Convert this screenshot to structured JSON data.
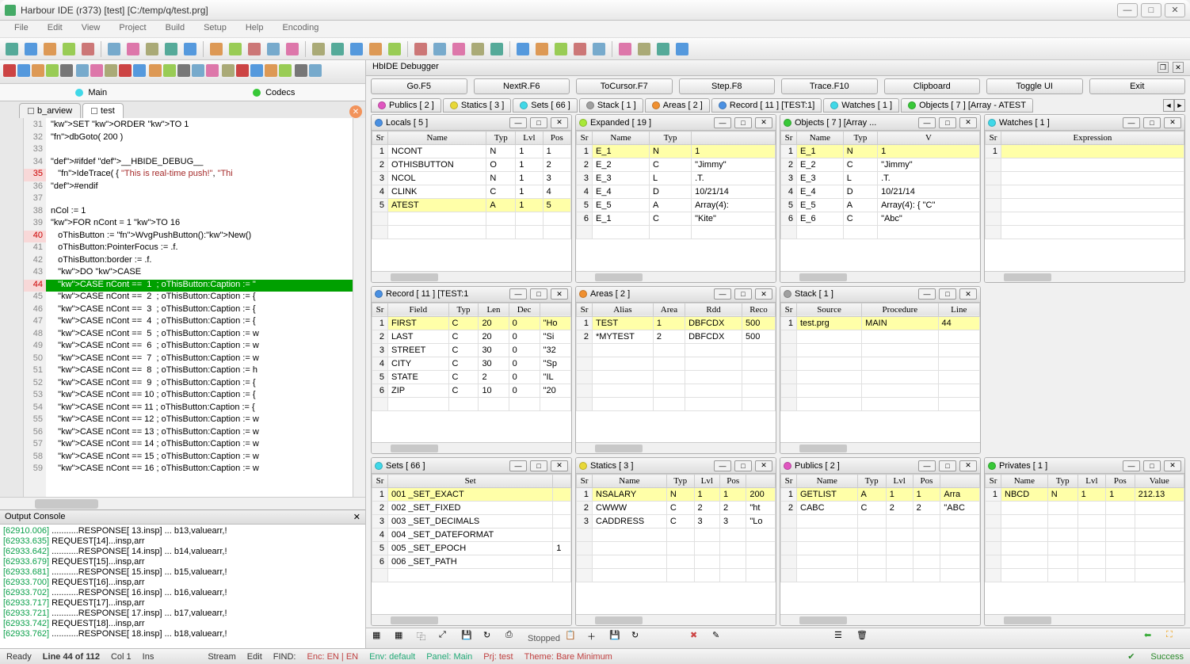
{
  "window": {
    "title": "Harbour IDE (r373) [test]   [C:/temp/q/test.prg]"
  },
  "menu": [
    "File",
    "Edit",
    "View",
    "Project",
    "Build",
    "Setup",
    "Help",
    "Encoding"
  ],
  "editor": {
    "tabgroups": [
      {
        "dot": "d-cyan",
        "label": "Main"
      },
      {
        "dot": "d-green",
        "label": "Codecs"
      }
    ],
    "filetabs": [
      {
        "label": "b_arview",
        "active": false
      },
      {
        "label": "test",
        "active": true
      }
    ],
    "firstLine": 31,
    "highlightLine": 44,
    "redLines": [
      35,
      40,
      44
    ],
    "lines": [
      "SET ORDER TO 1",
      "dbGoto( 200 )",
      "",
      "#ifdef __HBIDE_DEBUG__",
      "   IdeTrace( { \"This is real-time push!\", \"Thi",
      "#endif",
      "",
      "nCol := 1",
      "FOR nCont = 1 TO 16",
      "   oThisButton := WvgPushButton():New()",
      "   oThisButton:PointerFocus := .f.",
      "   oThisButton:border := .f.",
      "   DO CASE",
      "   CASE nCont ==  1  ; oThisButton:Caption := \"",
      "   CASE nCont ==  2  ; oThisButton:Caption := {",
      "   CASE nCont ==  3  ; oThisButton:Caption := {",
      "   CASE nCont ==  4  ; oThisButton:Caption := {",
      "   CASE nCont ==  5  ; oThisButton:Caption := w",
      "   CASE nCont ==  6  ; oThisButton:Caption := w",
      "   CASE nCont ==  7  ; oThisButton:Caption := w",
      "   CASE nCont ==  8  ; oThisButton:Caption := h",
      "   CASE nCont ==  9  ; oThisButton:Caption := {",
      "   CASE nCont == 10 ; oThisButton:Caption := {",
      "   CASE nCont == 11 ; oThisButton:Caption := {",
      "   CASE nCont == 12 ; oThisButton:Caption := w",
      "   CASE nCont == 13 ; oThisButton:Caption := w",
      "   CASE nCont == 14 ; oThisButton:Caption := w",
      "   CASE nCont == 15 ; oThisButton:Caption := w",
      "   CASE nCont == 16 ; oThisButton:Caption := w"
    ]
  },
  "console": {
    "title": "Output Console",
    "lines": [
      {
        "ts": "[62910.006]",
        "txt": " ...........RESPONSE[ 13.insp] ... b13,valuearr,!"
      },
      {
        "ts": "[62933.635]",
        "txt": " REQUEST[14]...insp,arr"
      },
      {
        "ts": "[62933.642]",
        "txt": " ...........RESPONSE[ 14.insp] ... b14,valuearr,!"
      },
      {
        "ts": "[62933.679]",
        "txt": " REQUEST[15]...insp,arr"
      },
      {
        "ts": "[62933.681]",
        "txt": " ...........RESPONSE[ 15.insp] ... b15,valuearr,!"
      },
      {
        "ts": "[62933.700]",
        "txt": " REQUEST[16]...insp,arr"
      },
      {
        "ts": "[62933.702]",
        "txt": " ...........RESPONSE[ 16.insp] ... b16,valuearr,!"
      },
      {
        "ts": "[62933.717]",
        "txt": " REQUEST[17]...insp,arr"
      },
      {
        "ts": "[62933.721]",
        "txt": " ...........RESPONSE[ 17.insp] ... b17,valuearr,!"
      },
      {
        "ts": "[62933.742]",
        "txt": " REQUEST[18]...insp,arr"
      },
      {
        "ts": "[62933.762]",
        "txt": " ...........RESPONSE[ 18.insp] ... b18,valuearr,!"
      }
    ]
  },
  "debugger": {
    "title": "HbIDE Debugger",
    "buttons": [
      "Go.F5",
      "NextR.F6",
      "ToCursor.F7",
      "Step.F8",
      "Trace.F10",
      "Clipboard",
      "Toggle UI",
      "Exit"
    ],
    "toptabs": [
      {
        "dot": "d-magenta",
        "label": "Publics [ 2 ]"
      },
      {
        "dot": "d-yellow",
        "label": "Statics [ 3 ]"
      },
      {
        "dot": "d-cyan",
        "label": "Sets [ 66 ]"
      },
      {
        "dot": "d-gray",
        "label": "Stack [ 1 ]"
      },
      {
        "dot": "d-orange",
        "label": "Areas [ 2 ]"
      },
      {
        "dot": "d-blue",
        "label": "Record [ 11 ] [TEST:1]"
      },
      {
        "dot": "d-cyan",
        "label": "Watches [ 1 ]"
      },
      {
        "dot": "d-green",
        "label": "Objects [ 7 ] [Array - ATEST"
      }
    ],
    "status": "Stopped"
  },
  "panels": {
    "locals": {
      "title": "Locals [ 5 ]",
      "dot": "d-blue",
      "cols": [
        "Sr",
        "Name",
        "Typ",
        "Lvl",
        "Pos"
      ],
      "rows": [
        [
          "1",
          "NCONT",
          "N",
          "1",
          "1"
        ],
        [
          "2",
          "OTHISBUTTON",
          "O",
          "1",
          "2"
        ],
        [
          "3",
          "NCOL",
          "N",
          "1",
          "3"
        ],
        [
          "4",
          "CLINK",
          "C",
          "1",
          "4"
        ],
        [
          "5",
          "ATEST",
          "A",
          "1",
          "5"
        ]
      ],
      "hl": 4
    },
    "expanded": {
      "title": "Expanded [ 19 ]",
      "dot": "d-lime",
      "cols": [
        "Sr",
        "Name",
        "Typ",
        ""
      ],
      "rows": [
        [
          "1",
          "E_1",
          "N",
          "1"
        ],
        [
          "2",
          "E_2",
          "C",
          "\"Jimmy\""
        ],
        [
          "3",
          "E_3",
          "L",
          ".T."
        ],
        [
          "4",
          "E_4",
          "D",
          "10/21/14"
        ],
        [
          "5",
          "E_5",
          "A",
          "Array(4):"
        ],
        [
          "6",
          "  E_1",
          "C",
          "\"Kite\""
        ]
      ],
      "hl": 0
    },
    "objects": {
      "title": "Objects [ 7 ] [Array ...",
      "dot": "d-green",
      "cols": [
        "Sr",
        "Name",
        "Typ",
        "V"
      ],
      "rows": [
        [
          "1",
          "E_1",
          "N",
          "1"
        ],
        [
          "2",
          "E_2",
          "C",
          "\"Jimmy\""
        ],
        [
          "3",
          "E_3",
          "L",
          ".T."
        ],
        [
          "4",
          "E_4",
          "D",
          "10/21/14"
        ],
        [
          "5",
          "E_5",
          "A",
          "Array(4): { \"C\""
        ],
        [
          "6",
          "E_6",
          "C",
          "\"Abc\""
        ]
      ],
      "hl": 0
    },
    "watches": {
      "title": "Watches [ 1 ]",
      "dot": "d-cyan",
      "cols": [
        "Sr",
        "Expression"
      ],
      "rows": [
        [
          "1",
          ""
        ]
      ],
      "hl": 0
    },
    "record": {
      "title": "Record [ 11 ] [TEST:1",
      "dot": "d-blue",
      "cols": [
        "Sr",
        "Field",
        "Typ",
        "Len",
        "Dec",
        ""
      ],
      "rows": [
        [
          "1",
          "FIRST",
          "C",
          "20",
          "0",
          "\"Ho"
        ],
        [
          "2",
          "LAST",
          "C",
          "20",
          "0",
          "\"Si"
        ],
        [
          "3",
          "STREET",
          "C",
          "30",
          "0",
          "\"32"
        ],
        [
          "4",
          "CITY",
          "C",
          "30",
          "0",
          "\"Sp"
        ],
        [
          "5",
          "STATE",
          "C",
          "2",
          "0",
          "\"IL"
        ],
        [
          "6",
          "ZIP",
          "C",
          "10",
          "0",
          "\"20"
        ]
      ],
      "hl": 0
    },
    "areas": {
      "title": "Areas [ 2 ]",
      "dot": "d-orange",
      "cols": [
        "Sr",
        "Alias",
        "Area",
        "Rdd",
        "Reco"
      ],
      "rows": [
        [
          "1",
          "TEST",
          "1",
          "DBFCDX",
          "500"
        ],
        [
          "2",
          "*MYTEST",
          "2",
          "DBFCDX",
          "500"
        ]
      ],
      "hl": 0
    },
    "stack": {
      "title": "Stack [ 1 ]",
      "dot": "d-gray",
      "cols": [
        "Sr",
        "Source",
        "Procedure",
        "Line"
      ],
      "rows": [
        [
          "1",
          "test.prg",
          "MAIN",
          "44"
        ]
      ],
      "hl": 0
    },
    "sets": {
      "title": "Sets [ 66 ]",
      "dot": "d-cyan",
      "cols": [
        "Sr",
        "Set",
        ""
      ],
      "rows": [
        [
          "1",
          "001 _SET_EXACT",
          ""
        ],
        [
          "2",
          "002 _SET_FIXED",
          ""
        ],
        [
          "3",
          "003 _SET_DECIMALS",
          ""
        ],
        [
          "4",
          "004 _SET_DATEFORMAT",
          ""
        ],
        [
          "5",
          "005 _SET_EPOCH",
          "1"
        ],
        [
          "6",
          "006 _SET_PATH",
          ""
        ]
      ],
      "hl": 0
    },
    "statics": {
      "title": "Statics [ 3 ]",
      "dot": "d-yellow",
      "cols": [
        "Sr",
        "Name",
        "Typ",
        "Lvl",
        "Pos",
        ""
      ],
      "rows": [
        [
          "1",
          "NSALARY",
          "N",
          "1",
          "1",
          "200"
        ],
        [
          "2",
          "CWWW",
          "C",
          "2",
          "2",
          "\"ht"
        ],
        [
          "3",
          "CADDRESS",
          "C",
          "3",
          "3",
          "\"Lo"
        ]
      ],
      "hl": 0
    },
    "publics": {
      "title": "Publics [ 2 ]",
      "dot": "d-magenta",
      "cols": [
        "Sr",
        "Name",
        "Typ",
        "Lvl",
        "Pos",
        ""
      ],
      "rows": [
        [
          "1",
          "GETLIST",
          "A",
          "1",
          "1",
          "Arra"
        ],
        [
          "2",
          "CABC",
          "C",
          "2",
          "2",
          "\"ABC"
        ]
      ],
      "hl": 0
    },
    "privates": {
      "title": "Privates [ 1 ]",
      "dot": "d-green",
      "cols": [
        "Sr",
        "Name",
        "Typ",
        "Lvl",
        "Pos",
        "Value"
      ],
      "rows": [
        [
          "1",
          "NBCD",
          "N",
          "1",
          "1",
          "212.13"
        ]
      ],
      "hl": 0
    }
  },
  "status": {
    "ready": "Ready",
    "line": "Line 44 of 112",
    "col": "Col 1",
    "ins": "Ins",
    "stream": "Stream",
    "edit": "Edit",
    "find": "FIND:",
    "enc": "Enc: EN | EN",
    "env": "Env: default",
    "panel": "Panel: Main",
    "prj": "Prj: test",
    "theme": "Theme: Bare Minimum",
    "success": "Success"
  }
}
